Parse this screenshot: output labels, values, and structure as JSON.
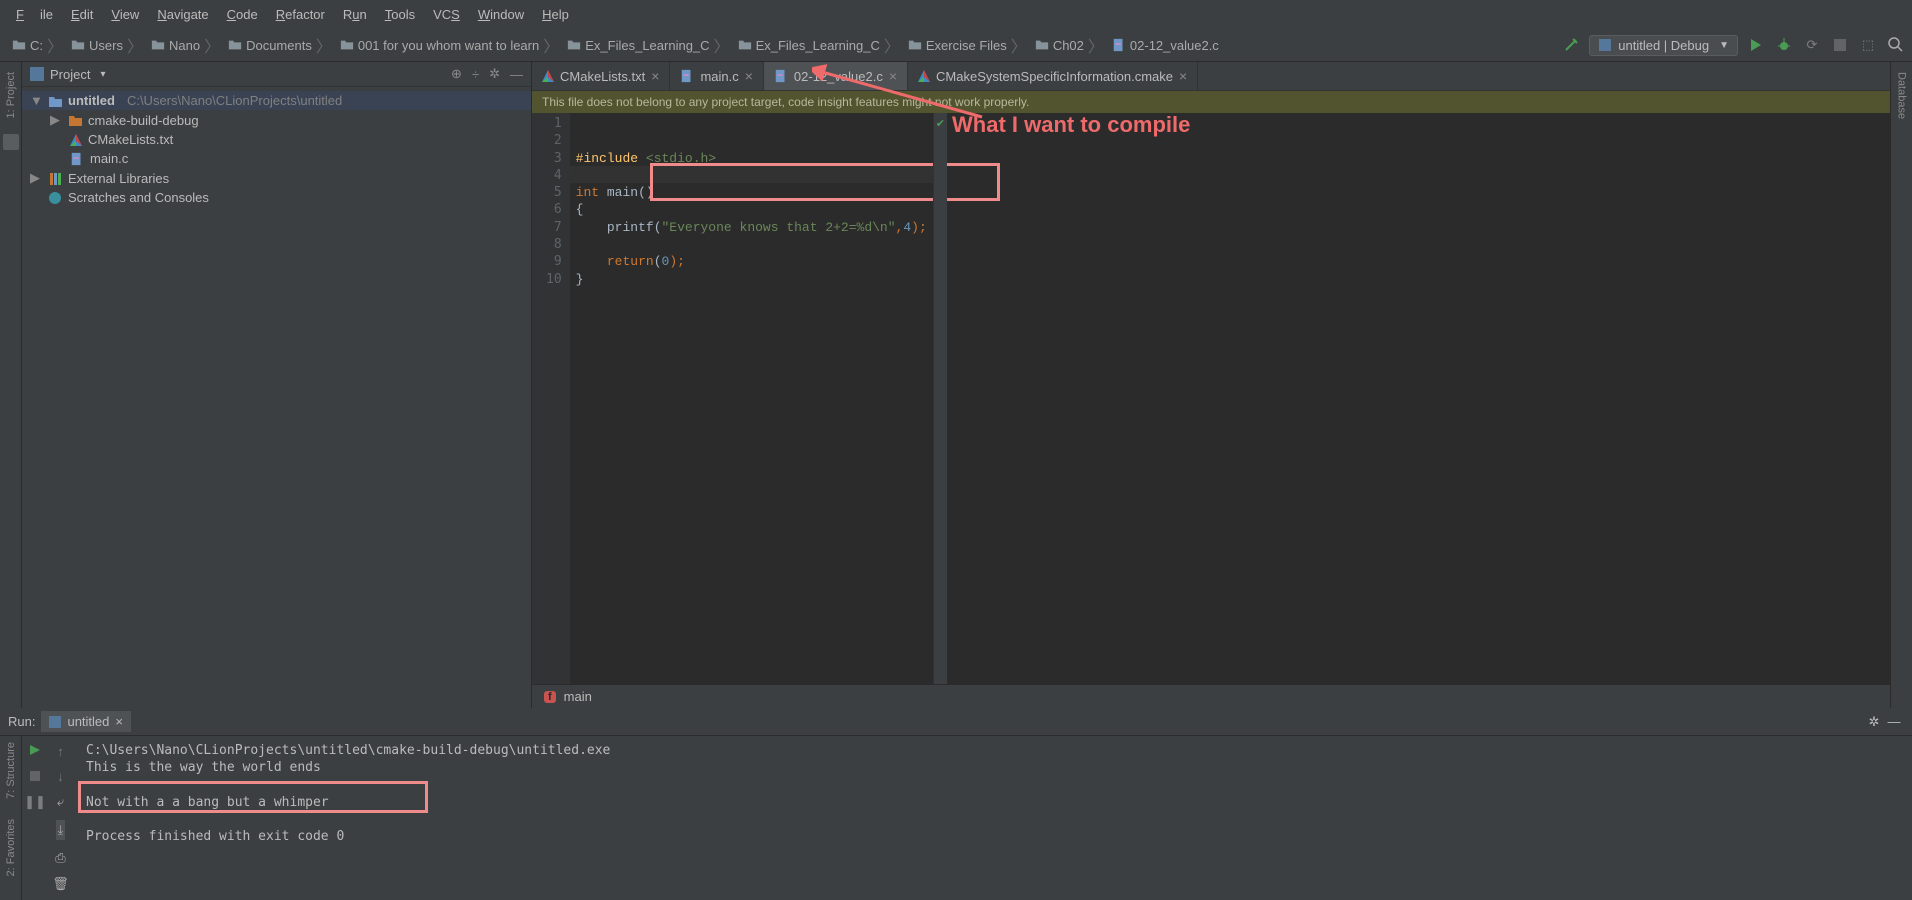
{
  "menu": {
    "file": "File",
    "edit": "Edit",
    "view": "View",
    "navigate": "Navigate",
    "code": "Code",
    "refactor": "Refactor",
    "run": "Run",
    "tools": "Tools",
    "vcs": "VCS",
    "window": "Window",
    "help": "Help"
  },
  "breadcrumbs": [
    "C:",
    "Users",
    "Nano",
    "Documents",
    "001 for you whom want to learn",
    "Ex_Files_Learning_C",
    "Ex_Files_Learning_C",
    "Exercise Files",
    "Ch02",
    "02-12_value2.c"
  ],
  "run_config": "untitled | Debug",
  "project_panel": {
    "title": "Project",
    "root": "untitled",
    "root_path": "C:\\Users\\Nano\\CLionProjects\\untitled",
    "children": [
      "cmake-build-debug",
      "CMakeLists.txt",
      "main.c"
    ],
    "ext_lib": "External Libraries",
    "scratches": "Scratches and Consoles"
  },
  "tabs": [
    {
      "name": "CMakeLists.txt",
      "id": "tab-cmakelists",
      "icon": "cmake"
    },
    {
      "name": "main.c",
      "id": "tab-mainc",
      "icon": "c"
    },
    {
      "name": "02-12_value2.c",
      "id": "tab-value2",
      "icon": "c",
      "active": true
    },
    {
      "name": "CMakeSystemSpecificInformation.cmake",
      "id": "tab-cmakesys",
      "icon": "cmake"
    }
  ],
  "warning": "This file does not belong to any project target, code insight features might not work properly.",
  "code_lines": [
    "1",
    "2",
    "3",
    "4",
    "5",
    "6",
    "7",
    "8",
    "9",
    "10"
  ],
  "code": {
    "inc": "#include",
    "inc_arg": "<stdio.h>",
    "int": "int",
    "main": "main",
    "paren": "()",
    "ob": "{",
    "printf": "printf",
    "open": "(",
    "str": "\"Everyone knows that 2+2=%d\\n\"",
    "comma": ",",
    "four": "4",
    "close": ");",
    "ret": "return",
    "retp": "(",
    "zero": "0",
    "retc": ");",
    "cb": "}"
  },
  "func_crumb": "main",
  "run": {
    "label": "Run:",
    "tab": "untitled",
    "path": "C:\\Users\\Nano\\CLionProjects\\untitled\\cmake-build-debug\\untitled.exe",
    "l1": "This is the way the world ends",
    "l2": "",
    "l3": "Not with a a bang but a whimper",
    "l4": "",
    "exit": "Process finished with exit code 0"
  },
  "annotation": "What I want to compile",
  "leftgutter": {
    "project": "1: Project",
    "structure": "7: Structure",
    "favorites": "2: Favorites"
  },
  "rightgutter": {
    "database": "Database"
  }
}
